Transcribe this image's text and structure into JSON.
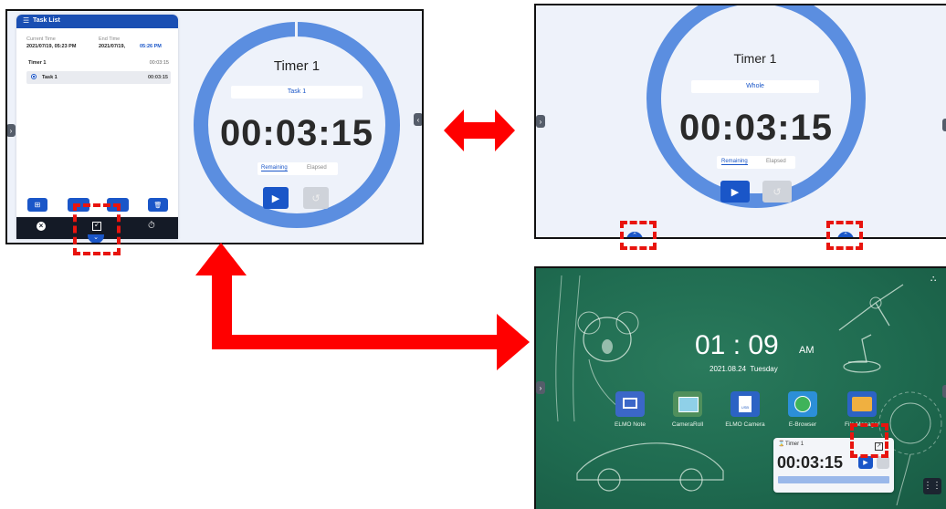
{
  "panel_a": {
    "sidebar_title": "Task List",
    "current_time_label": "Current Time",
    "current_time_value": "2021/07/19, 05:23 PM",
    "end_time_label": "End Time",
    "end_time_date": "2021/07/19,",
    "end_time_clock": "05:26 PM",
    "timer_name": "Timer 1",
    "timer_total": "00:03:15",
    "task_name": "Task 1",
    "task_time": "00:03:15",
    "clock_title": "Timer 1",
    "task_badge": "Task 1",
    "countdown": "00:03:15",
    "tab_remaining": "Remaining",
    "tab_elapsed": "Elapsed"
  },
  "panel_b": {
    "clock_title": "Timer 1",
    "mode_badge": "Whole",
    "countdown": "00:03:15",
    "tab_remaining": "Remaining",
    "tab_elapsed": "Elapsed"
  },
  "panel_c": {
    "clock_time": "01 : 09",
    "clock_ampm": "AM",
    "date": "2021.08.24  Tuesday",
    "apps": [
      {
        "label": "ELMO Note",
        "icon": "note-app-icon",
        "color": "#3b67c8"
      },
      {
        "label": "CameraRoll",
        "icon": "camera-roll-app-icon",
        "color": "#4f8f5c"
      },
      {
        "label": "ELMO Camera",
        "icon": "elmo-camera-app-icon",
        "color": "#2c63c4"
      },
      {
        "label": "E-Browser",
        "icon": "browser-app-icon",
        "color": "#2c8fd8"
      },
      {
        "label": "File Manager",
        "icon": "file-manager-app-icon",
        "color": "#e8a23a"
      }
    ],
    "widget_title": "Timer 1",
    "widget_countdown": "00:03:15"
  },
  "colors": {
    "accent": "#1a56c8",
    "ring": "#5b8ee0",
    "highlight": "#e8140e",
    "board": "#1f6b50"
  }
}
